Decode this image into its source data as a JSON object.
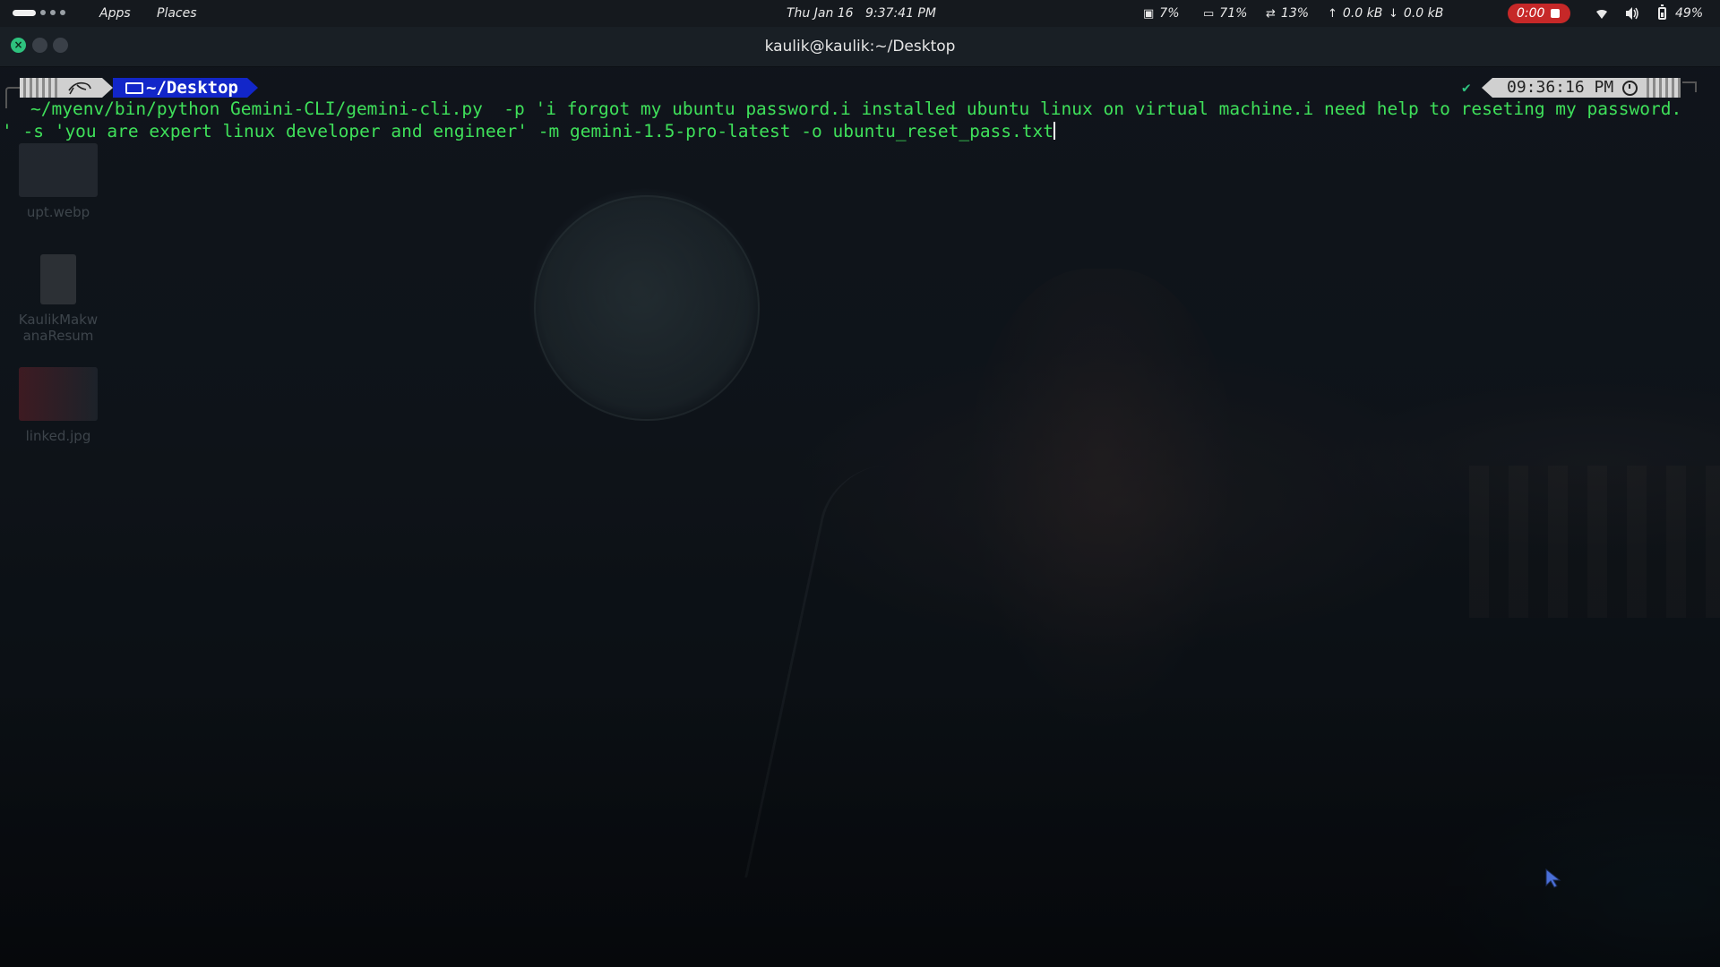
{
  "top_panel": {
    "apps_label": "Apps",
    "places_label": "Places",
    "date": "Thu Jan 16",
    "time": "9:37:41 PM",
    "cpu": "7%",
    "memory": "71%",
    "swap": "13%",
    "upload": "0.0 kB",
    "download": "0.0 kB",
    "recording_timer": "0:00",
    "battery": "49%",
    "recording_color": "#c62828"
  },
  "window": {
    "title": "kaulik@kaulik:~/Desktop"
  },
  "desktop_icons": [
    {
      "label": "upt.webp",
      "icon": "image-icon"
    },
    {
      "label": "KaulikMakwanaResum",
      "icon": "document-icon"
    },
    {
      "label": "linked.jpg",
      "icon": "image-icon"
    }
  ],
  "prompt": {
    "directory": "~/Desktop",
    "status": "✔",
    "time": "09:36:16 PM"
  },
  "command": {
    "line1": "~/myenv/bin/python Gemini-CLI/gemini-cli.py  -p 'i forgot my ubuntu password.i installed ubuntu linux on virtual machine.i need help to reseting my password.",
    "line2": "' -s 'you are expert linux developer and engineer' -m gemini-1.5-pro-latest -o ubuntu_reset_pass.txt",
    "text_color": "#3fe05a"
  }
}
